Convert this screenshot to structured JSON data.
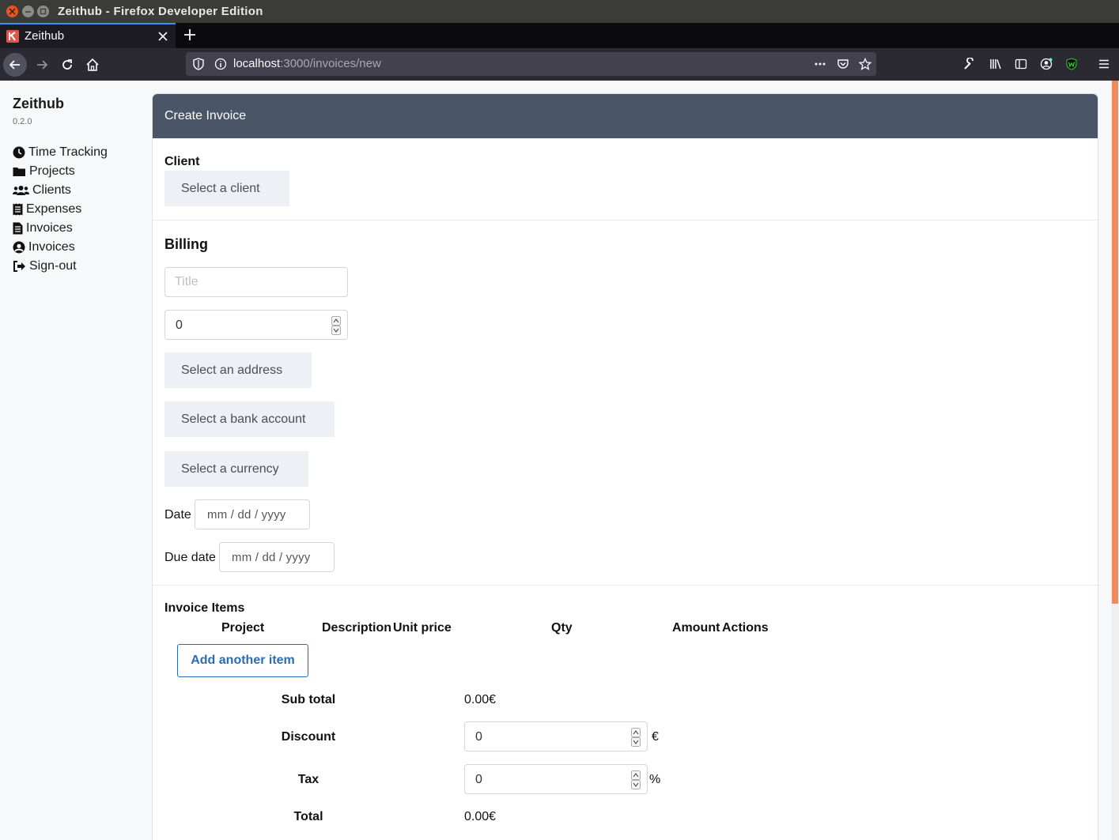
{
  "window": {
    "title": "Zeithub - Firefox Developer Edition"
  },
  "tabs": [
    {
      "title": "Zeithub"
    }
  ],
  "urlbar": {
    "host": "localhost",
    "path": ":3000/invoices/new"
  },
  "sidebar": {
    "brand": "Zeithub",
    "version": "0.2.0",
    "items": [
      {
        "label": "Time Tracking",
        "icon": "clock-icon"
      },
      {
        "label": "Projects",
        "icon": "folder-icon"
      },
      {
        "label": "Clients",
        "icon": "users-icon"
      },
      {
        "label": "Expenses",
        "icon": "receipt-icon"
      },
      {
        "label": "Invoices",
        "icon": "file-invoice-icon"
      },
      {
        "label": "Invoices",
        "icon": "user-circle-icon"
      },
      {
        "label": "Sign-out",
        "icon": "sign-out-icon"
      }
    ]
  },
  "form": {
    "header": "Create Invoice",
    "client": {
      "label": "Client",
      "select": "Select a client"
    },
    "billing": {
      "heading": "Billing",
      "title_placeholder": "Title",
      "number_value": "0",
      "address_select": "Select an address",
      "bank_select": "Select a bank account",
      "currency_select": "Select a currency",
      "date_label": "Date",
      "date_value": "mm / dd / yyyy",
      "due_label": "Due date",
      "due_value": "mm / dd / yyyy"
    },
    "items": {
      "heading": "Invoice Items",
      "columns": [
        "Project",
        "Description",
        "Unit price",
        "Qty",
        "Amount",
        "Actions"
      ],
      "add_button": "Add another item"
    },
    "summary": {
      "subtotal_label": "Sub total",
      "subtotal_value": "0.00€",
      "discount_label": "Discount",
      "discount_value": "0",
      "discount_unit": "€",
      "tax_label": "Tax",
      "tax_value": "0",
      "tax_unit": "%",
      "total_label": "Total",
      "total_value": "0.00€"
    }
  },
  "colors": {
    "header_bg": "#4a5568",
    "accent": "#2b6cb0",
    "scroll_thumb": "#f08a5d"
  }
}
